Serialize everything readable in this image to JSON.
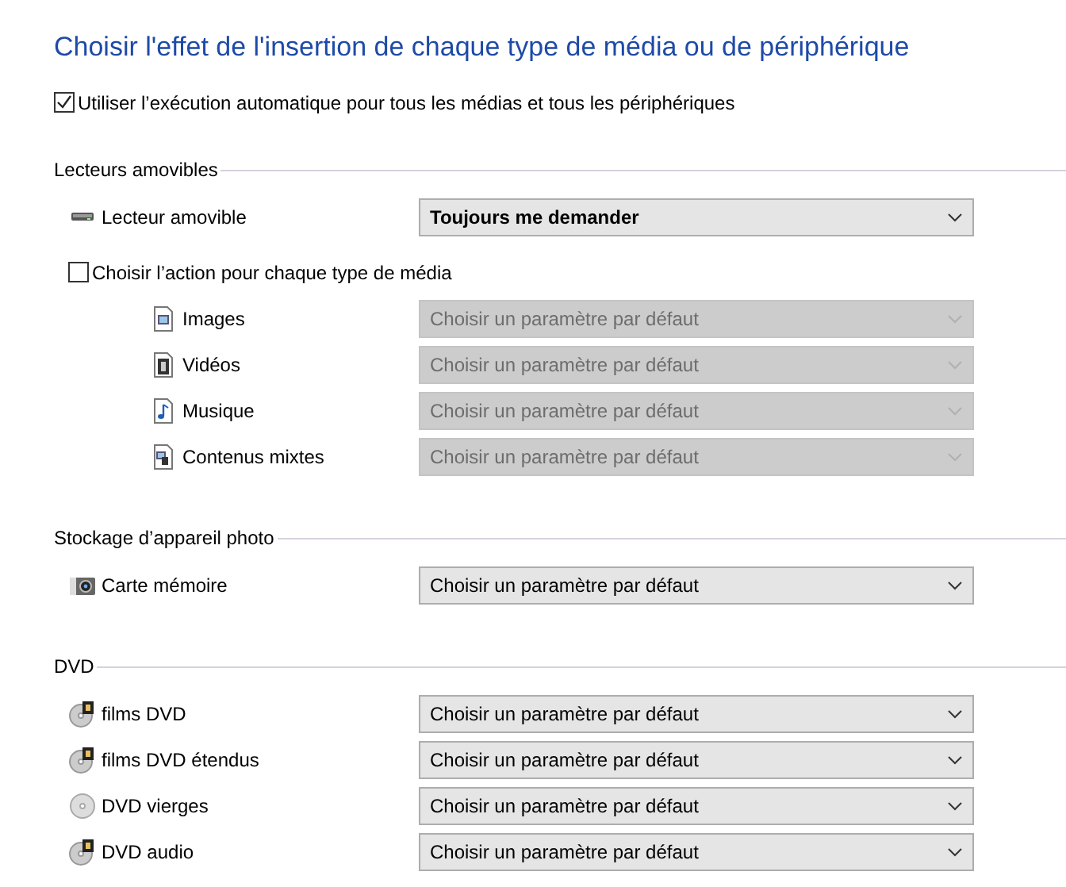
{
  "title": "Choisir l'effet de l'insertion de chaque type de média ou de périphérique",
  "autoplay": {
    "label": "Utiliser l’exécution automatique pour tous les médias et tous les périphériques",
    "checked": true
  },
  "sections": [
    {
      "heading": "Lecteurs amovibles",
      "items": [
        {
          "kind": "drive",
          "label": "Lecteur amovible",
          "dropdown": {
            "value": "Toujours me demander",
            "disabled": false
          }
        },
        {
          "kind": "checkbox",
          "label": "Choisir l’action pour chaque type de média",
          "checked": false,
          "children": [
            {
              "kind": "image",
              "label": "Images",
              "dropdown": {
                "value": "Choisir un paramètre par défaut",
                "disabled": true
              }
            },
            {
              "kind": "video",
              "label": "Vidéos",
              "dropdown": {
                "value": "Choisir un paramètre par défaut",
                "disabled": true
              }
            },
            {
              "kind": "music",
              "label": "Musique",
              "dropdown": {
                "value": "Choisir un paramètre par défaut",
                "disabled": true
              }
            },
            {
              "kind": "mixed",
              "label": "Contenus mixtes",
              "dropdown": {
                "value": "Choisir un paramètre par défaut",
                "disabled": true
              }
            }
          ]
        }
      ]
    },
    {
      "heading": "Stockage d’appareil photo",
      "items": [
        {
          "kind": "camera",
          "label": "Carte mémoire",
          "dropdown": {
            "value": "Choisir un paramètre par défaut",
            "disabled": false
          }
        }
      ]
    },
    {
      "heading": "DVD",
      "items": [
        {
          "kind": "dvd-film",
          "label": "films DVD",
          "dropdown": {
            "value": "Choisir un paramètre par défaut",
            "disabled": false
          }
        },
        {
          "kind": "dvd-film",
          "label": "films DVD étendus",
          "dropdown": {
            "value": "Choisir un paramètre par défaut",
            "disabled": false
          }
        },
        {
          "kind": "disc",
          "label": "DVD vierges",
          "dropdown": {
            "value": "Choisir un paramètre par défaut",
            "disabled": false
          }
        },
        {
          "kind": "dvd-film",
          "label": "DVD audio",
          "dropdown": {
            "value": "Choisir un paramètre par défaut",
            "disabled": false
          }
        }
      ]
    }
  ]
}
